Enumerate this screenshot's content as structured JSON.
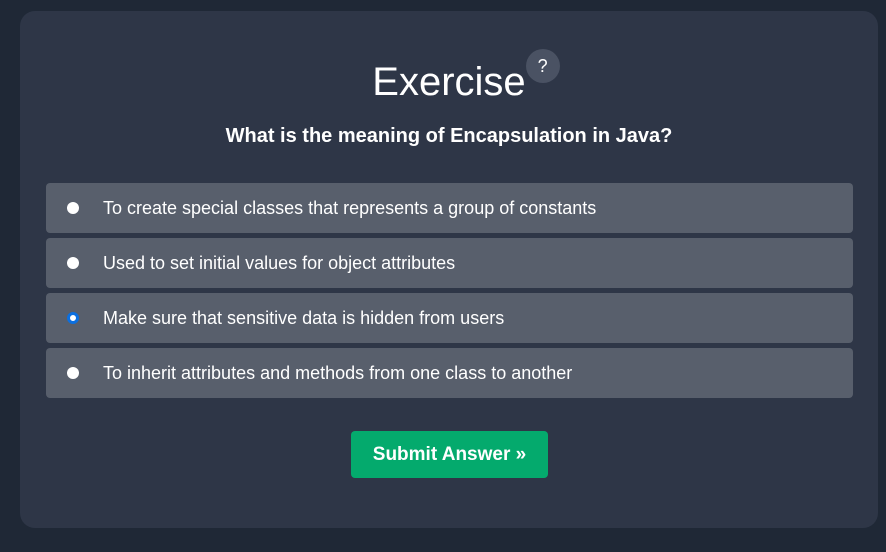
{
  "exercise": {
    "title": "Exercise",
    "help_label": "?",
    "question_prefix": "What is the meaning of ",
    "question_keyword": "Encapsulation",
    "question_suffix": " in Java?",
    "options": [
      {
        "label": "To create special classes that represents a group of constants",
        "selected": false
      },
      {
        "label": "Used to set initial values for object attributes",
        "selected": false
      },
      {
        "label": "Make sure that sensitive data is hidden from users",
        "selected": true
      },
      {
        "label": "To inherit attributes and methods from one class to another",
        "selected": false
      }
    ],
    "submit_label": "Submit Answer »"
  },
  "colors": {
    "page_background": "#1f2836",
    "panel_background": "#2e3647",
    "option_background": "#585f6c",
    "radio_selected": "#0b6fe0",
    "submit_background": "#04aa6d"
  }
}
